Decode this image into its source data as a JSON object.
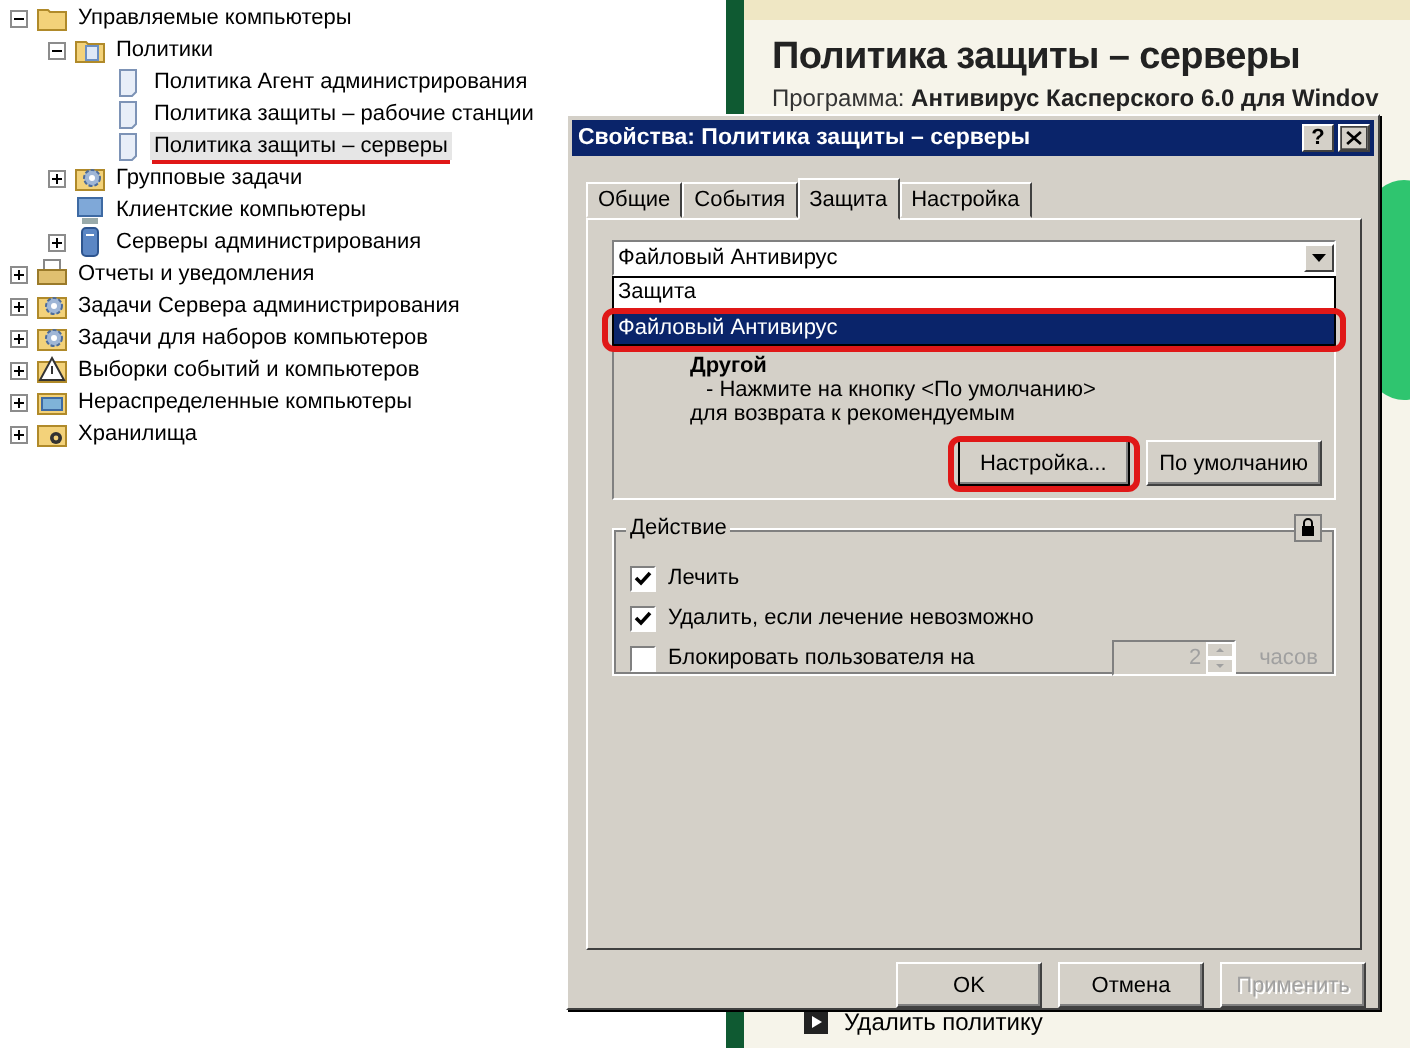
{
  "tree": [
    {
      "label": "Управляемые компьютеры",
      "kind": "folder",
      "expanded": true,
      "children": [
        {
          "label": "Политики",
          "kind": "policies",
          "expanded": true,
          "children": [
            {
              "label": "Политика Агент администрирования",
              "kind": "policy",
              "selected": false,
              "underlined": false
            },
            {
              "label": "Политика защиты – рабочие станции",
              "kind": "policy",
              "selected": false,
              "underlined": false
            },
            {
              "label": "Политика защиты – серверы",
              "kind": "policy",
              "selected": true,
              "underlined": true
            }
          ]
        },
        {
          "label": "Групповые задачи",
          "kind": "tasks",
          "expanded": false
        },
        {
          "label": "Клиентские компьютеры",
          "kind": "clients"
        },
        {
          "label": "Серверы администрирования",
          "kind": "servers",
          "expanded": false
        }
      ]
    },
    {
      "label": "Отчеты и уведомления",
      "kind": "reports",
      "expanded": false
    },
    {
      "label": "Задачи Сервера администрирования",
      "kind": "tasks",
      "expanded": false
    },
    {
      "label": "Задачи для наборов компьютеров",
      "kind": "tasks",
      "expanded": false
    },
    {
      "label": "Выборки событий и компьютеров",
      "kind": "alerts",
      "expanded": false
    },
    {
      "label": "Нераспределенные компьютеры",
      "kind": "unassigned",
      "expanded": false
    },
    {
      "label": "Хранилища",
      "kind": "storage",
      "expanded": false
    }
  ],
  "details": {
    "title": "Политика защиты – серверы",
    "subtitle_label": "Программа: ",
    "subtitle_value": "Антивирус Касперского 6.0 для Windov",
    "action": "Удалить политику"
  },
  "dialog": {
    "title": "Свойства: Политика защиты – серверы",
    "help": "?",
    "tabs": [
      {
        "label": "Общие",
        "selected": false
      },
      {
        "label": "События",
        "selected": false
      },
      {
        "label": "Защита",
        "selected": true
      },
      {
        "label": "Настройка",
        "selected": false
      }
    ],
    "component": {
      "value": "Файловый Антивирус",
      "options": [
        {
          "label": "Защита",
          "selected": false,
          "circled": false
        },
        {
          "label": "Файловый Антивирус",
          "selected": true,
          "circled": true
        }
      ]
    },
    "level": {
      "heading": "Другой",
      "lines": [
        "- Нажмите на кнопку <По умолчанию>",
        "для возврата к рекомендуемым"
      ],
      "buttons": [
        {
          "label": "Настройка...",
          "circled": true
        },
        {
          "label": "По умолчанию",
          "circled": false
        }
      ]
    },
    "action_group": {
      "title": "Действие",
      "locked": true,
      "options": [
        {
          "kind": "checkbox",
          "label": "Лечить",
          "checked": true
        },
        {
          "kind": "checkbox",
          "label": "Удалить, если лечение невозможно",
          "checked": true
        },
        {
          "kind": "checkbox_spin",
          "label": "Блокировать пользователя на",
          "checked": false,
          "value": "2",
          "unit": "часов"
        }
      ]
    },
    "buttons": [
      {
        "label": "OK",
        "disabled": false
      },
      {
        "label": "Отмена",
        "disabled": false
      },
      {
        "label": "Применить",
        "disabled": true
      }
    ]
  }
}
